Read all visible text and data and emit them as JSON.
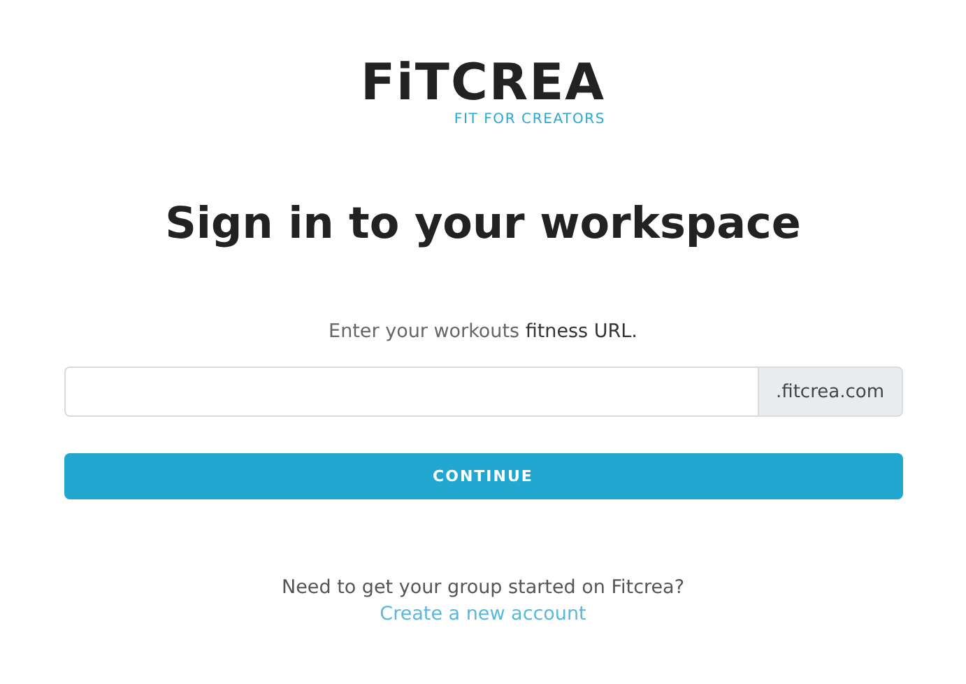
{
  "logo": {
    "name": "FiTCREA",
    "tagline": "FIT FOR CREATORS"
  },
  "heading": "Sign in to your workspace",
  "prompt": "Enter your workouts **fitness URL.**",
  "url_field": {
    "suffix": ".fitcrea.com"
  },
  "continue_button": "CONTINUE",
  "footer": {
    "question": "Need to get your group started on Fitcrea?",
    "link": "Create a new account"
  }
}
